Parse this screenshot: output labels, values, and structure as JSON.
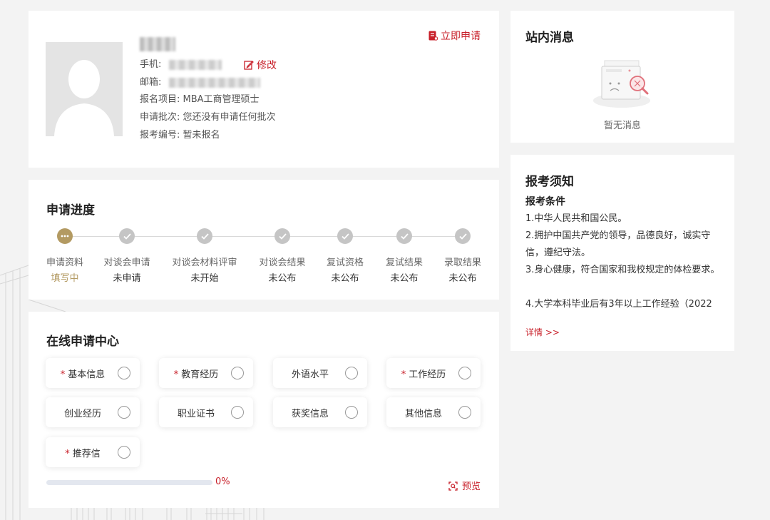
{
  "profile": {
    "name": "",
    "phone_label": "手机:",
    "edit_label": "修改",
    "email_label": "邮箱:",
    "program_label": "报名项目:",
    "program_value": "MBA工商管理硕士",
    "batch_label": "申请批次:",
    "batch_value": "您还没有申请任何批次",
    "exam_no_label": "报考编号:",
    "exam_no_value": "暂未报名",
    "apply_label": "立即申请"
  },
  "progress": {
    "title": "申请进度",
    "steps": [
      {
        "name": "申请资料",
        "status": "填写中",
        "active": true
      },
      {
        "name": "对谈会申请",
        "status": "未申请",
        "active": false
      },
      {
        "name": "对谈会材料评审",
        "status": "未开始",
        "active": false
      },
      {
        "name": "对谈会结果",
        "status": "未公布",
        "active": false
      },
      {
        "name": "复试资格",
        "status": "未公布",
        "active": false
      },
      {
        "name": "复试结果",
        "status": "未公布",
        "active": false
      },
      {
        "name": "录取结果",
        "status": "未公布",
        "active": false
      }
    ]
  },
  "center": {
    "title": "在线申请中心",
    "items": [
      {
        "label": "基本信息",
        "required": true
      },
      {
        "label": "教育经历",
        "required": true
      },
      {
        "label": "外语水平",
        "required": false
      },
      {
        "label": "工作经历",
        "required": true
      },
      {
        "label": "创业经历",
        "required": false
      },
      {
        "label": "职业证书",
        "required": false
      },
      {
        "label": "获奖信息",
        "required": false
      },
      {
        "label": "其他信息",
        "required": false
      },
      {
        "label": "推荐信",
        "required": true
      }
    ],
    "required_mark": "*",
    "progress_percent": 0,
    "progress_text": "0%",
    "preview_label": "预览"
  },
  "messages": {
    "title": "站内消息",
    "empty_text": "暂无消息"
  },
  "notice": {
    "title": "报考须知",
    "subtitle": "报考条件",
    "items": [
      "1.中华人民共和国公民。",
      "2.拥护中国共产党的领导，品德良好，诚实守信，遵纪守法。",
      "3.身心健康，符合国家和我校规定的体检要求。",
      "4.大学本科毕业后有3年以上工作经验（2022"
    ],
    "details_label": "详情 >>"
  },
  "colors": {
    "accent": "#c8202a",
    "active_step": "#b39a62",
    "inactive_step": "#c5c5c5",
    "background": "#f3f3f3"
  }
}
